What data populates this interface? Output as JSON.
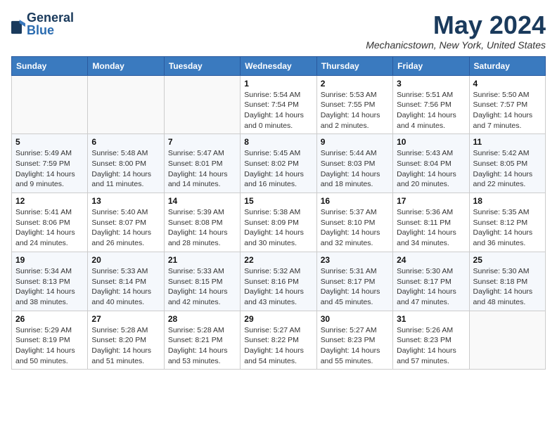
{
  "header": {
    "logo_general": "General",
    "logo_blue": "Blue",
    "month_title": "May 2024",
    "location": "Mechanicstown, New York, United States"
  },
  "days_of_week": [
    "Sunday",
    "Monday",
    "Tuesday",
    "Wednesday",
    "Thursday",
    "Friday",
    "Saturday"
  ],
  "weeks": [
    [
      {
        "num": "",
        "info": ""
      },
      {
        "num": "",
        "info": ""
      },
      {
        "num": "",
        "info": ""
      },
      {
        "num": "1",
        "info": "Sunrise: 5:54 AM\nSunset: 7:54 PM\nDaylight: 14 hours\nand 0 minutes."
      },
      {
        "num": "2",
        "info": "Sunrise: 5:53 AM\nSunset: 7:55 PM\nDaylight: 14 hours\nand 2 minutes."
      },
      {
        "num": "3",
        "info": "Sunrise: 5:51 AM\nSunset: 7:56 PM\nDaylight: 14 hours\nand 4 minutes."
      },
      {
        "num": "4",
        "info": "Sunrise: 5:50 AM\nSunset: 7:57 PM\nDaylight: 14 hours\nand 7 minutes."
      }
    ],
    [
      {
        "num": "5",
        "info": "Sunrise: 5:49 AM\nSunset: 7:59 PM\nDaylight: 14 hours\nand 9 minutes."
      },
      {
        "num": "6",
        "info": "Sunrise: 5:48 AM\nSunset: 8:00 PM\nDaylight: 14 hours\nand 11 minutes."
      },
      {
        "num": "7",
        "info": "Sunrise: 5:47 AM\nSunset: 8:01 PM\nDaylight: 14 hours\nand 14 minutes."
      },
      {
        "num": "8",
        "info": "Sunrise: 5:45 AM\nSunset: 8:02 PM\nDaylight: 14 hours\nand 16 minutes."
      },
      {
        "num": "9",
        "info": "Sunrise: 5:44 AM\nSunset: 8:03 PM\nDaylight: 14 hours\nand 18 minutes."
      },
      {
        "num": "10",
        "info": "Sunrise: 5:43 AM\nSunset: 8:04 PM\nDaylight: 14 hours\nand 20 minutes."
      },
      {
        "num": "11",
        "info": "Sunrise: 5:42 AM\nSunset: 8:05 PM\nDaylight: 14 hours\nand 22 minutes."
      }
    ],
    [
      {
        "num": "12",
        "info": "Sunrise: 5:41 AM\nSunset: 8:06 PM\nDaylight: 14 hours\nand 24 minutes."
      },
      {
        "num": "13",
        "info": "Sunrise: 5:40 AM\nSunset: 8:07 PM\nDaylight: 14 hours\nand 26 minutes."
      },
      {
        "num": "14",
        "info": "Sunrise: 5:39 AM\nSunset: 8:08 PM\nDaylight: 14 hours\nand 28 minutes."
      },
      {
        "num": "15",
        "info": "Sunrise: 5:38 AM\nSunset: 8:09 PM\nDaylight: 14 hours\nand 30 minutes."
      },
      {
        "num": "16",
        "info": "Sunrise: 5:37 AM\nSunset: 8:10 PM\nDaylight: 14 hours\nand 32 minutes."
      },
      {
        "num": "17",
        "info": "Sunrise: 5:36 AM\nSunset: 8:11 PM\nDaylight: 14 hours\nand 34 minutes."
      },
      {
        "num": "18",
        "info": "Sunrise: 5:35 AM\nSunset: 8:12 PM\nDaylight: 14 hours\nand 36 minutes."
      }
    ],
    [
      {
        "num": "19",
        "info": "Sunrise: 5:34 AM\nSunset: 8:13 PM\nDaylight: 14 hours\nand 38 minutes."
      },
      {
        "num": "20",
        "info": "Sunrise: 5:33 AM\nSunset: 8:14 PM\nDaylight: 14 hours\nand 40 minutes."
      },
      {
        "num": "21",
        "info": "Sunrise: 5:33 AM\nSunset: 8:15 PM\nDaylight: 14 hours\nand 42 minutes."
      },
      {
        "num": "22",
        "info": "Sunrise: 5:32 AM\nSunset: 8:16 PM\nDaylight: 14 hours\nand 43 minutes."
      },
      {
        "num": "23",
        "info": "Sunrise: 5:31 AM\nSunset: 8:17 PM\nDaylight: 14 hours\nand 45 minutes."
      },
      {
        "num": "24",
        "info": "Sunrise: 5:30 AM\nSunset: 8:17 PM\nDaylight: 14 hours\nand 47 minutes."
      },
      {
        "num": "25",
        "info": "Sunrise: 5:30 AM\nSunset: 8:18 PM\nDaylight: 14 hours\nand 48 minutes."
      }
    ],
    [
      {
        "num": "26",
        "info": "Sunrise: 5:29 AM\nSunset: 8:19 PM\nDaylight: 14 hours\nand 50 minutes."
      },
      {
        "num": "27",
        "info": "Sunrise: 5:28 AM\nSunset: 8:20 PM\nDaylight: 14 hours\nand 51 minutes."
      },
      {
        "num": "28",
        "info": "Sunrise: 5:28 AM\nSunset: 8:21 PM\nDaylight: 14 hours\nand 53 minutes."
      },
      {
        "num": "29",
        "info": "Sunrise: 5:27 AM\nSunset: 8:22 PM\nDaylight: 14 hours\nand 54 minutes."
      },
      {
        "num": "30",
        "info": "Sunrise: 5:27 AM\nSunset: 8:23 PM\nDaylight: 14 hours\nand 55 minutes."
      },
      {
        "num": "31",
        "info": "Sunrise: 5:26 AM\nSunset: 8:23 PM\nDaylight: 14 hours\nand 57 minutes."
      },
      {
        "num": "",
        "info": ""
      }
    ]
  ]
}
